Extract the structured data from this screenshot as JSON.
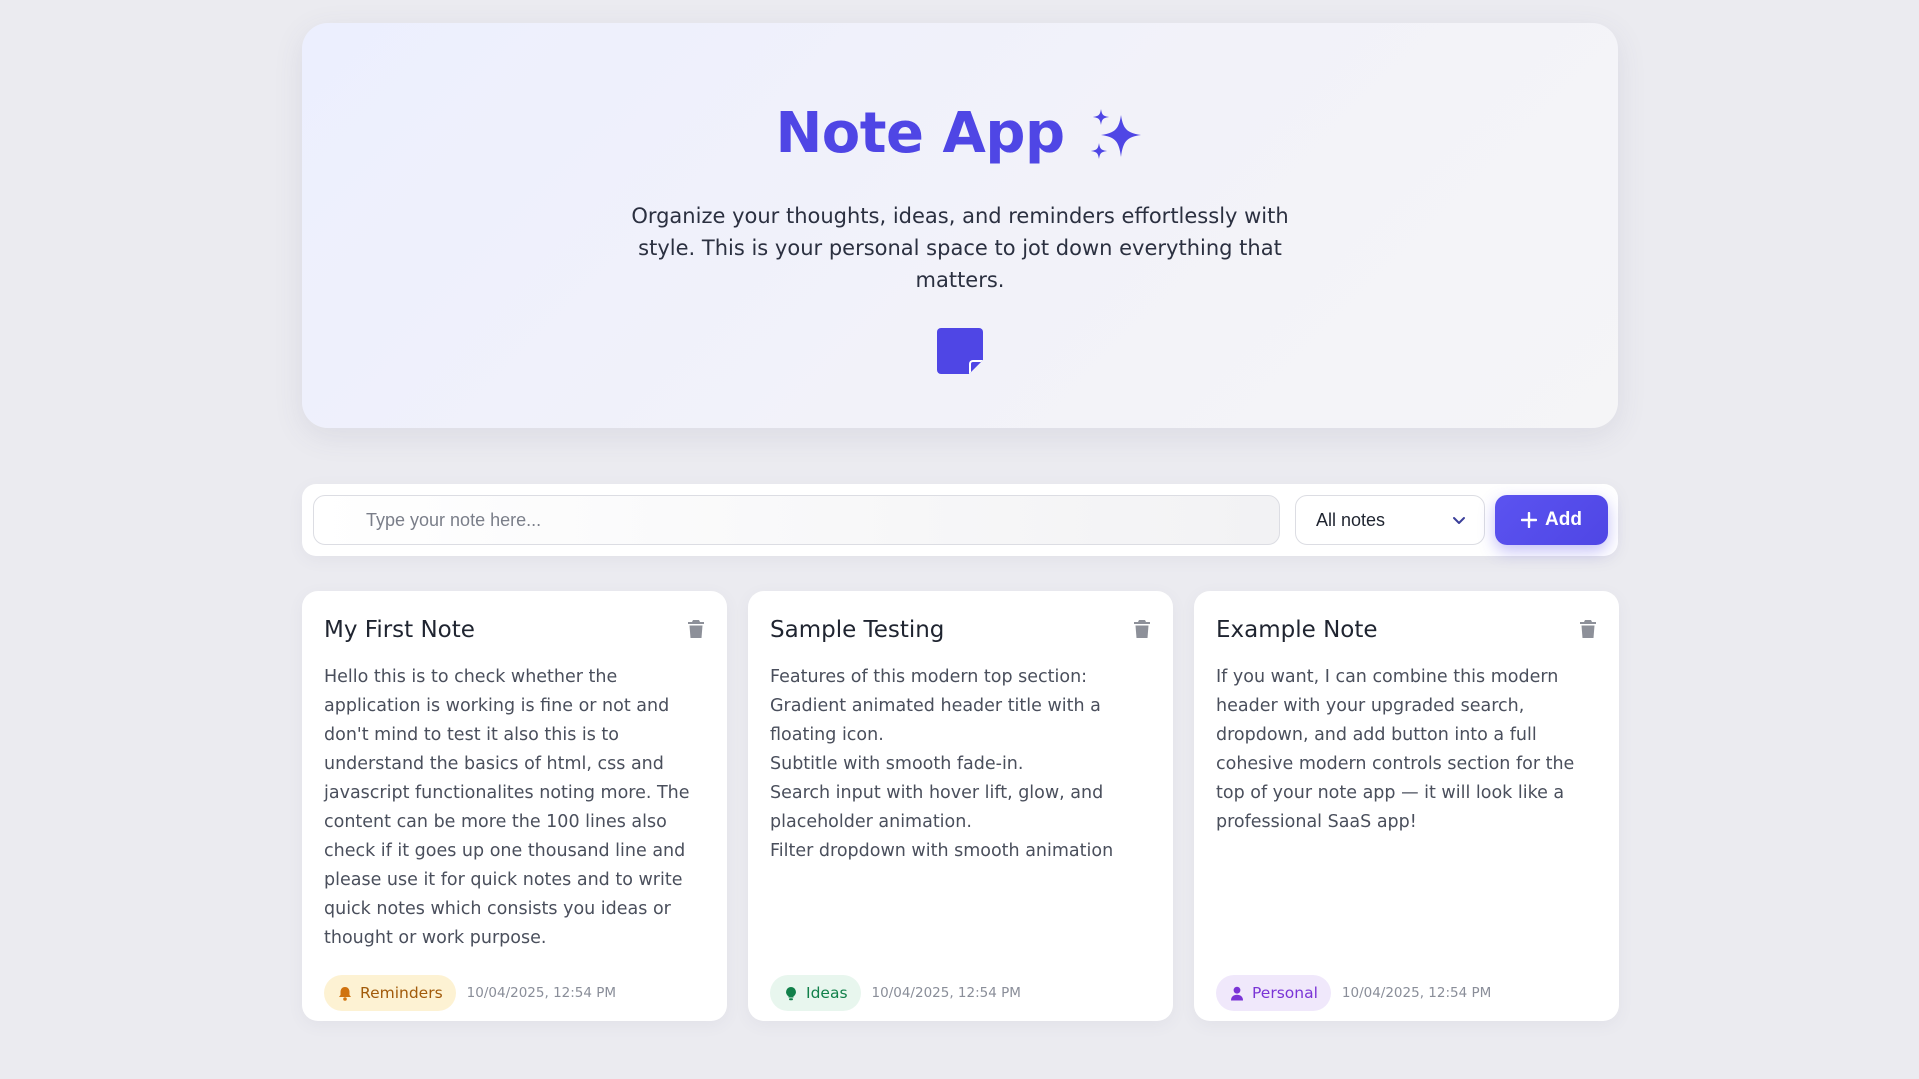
{
  "header": {
    "title": "Note App",
    "subtitle": "Organize your thoughts, ideas, and reminders effortlessly with style. This is your personal space to jot down everything that matters.",
    "title_icon": "sparkles-icon",
    "hero_icon": "sticky-note-icon"
  },
  "controls": {
    "search_placeholder": "Type your note here...",
    "filter_selected": "All notes",
    "add_label": "Add"
  },
  "notes": [
    {
      "title": "My First Note",
      "body": "Hello this is to check whether the application is working is fine or not and don't mind to test it also this is to understand the basics of html, css and javascript functionalites noting more. The content can be more the 100 lines also check if it goes up one thousand line and please use it for quick notes and to write quick notes which consists you ideas or thought or work purpose.",
      "category": "Reminders",
      "category_icon": "bell-icon",
      "timestamp": "10/04/2025, 12:54 PM"
    },
    {
      "title": "Sample Testing",
      "body": "Features of this modern top section:\nGradient animated header title with a floating icon.\nSubtitle with smooth fade-in.\nSearch input with hover lift, glow, and placeholder animation.\nFilter dropdown with smooth animation",
      "category": "Ideas",
      "category_icon": "lightbulb-icon",
      "timestamp": "10/04/2025, 12:54 PM"
    },
    {
      "title": "Example Note",
      "body": "If you want, I can combine this modern header with your upgraded search, dropdown, and add button into a full cohesive modern controls section for the top of your note app — it will look like a professional SaaS app!",
      "category": "Personal",
      "category_icon": "user-icon",
      "timestamp": "10/04/2025, 12:54 PM"
    }
  ],
  "colors": {
    "accent": "#4f46e5",
    "background": "#ebebf0",
    "reminders_bg": "#fdf2d3",
    "reminders_fg": "#a15a0a",
    "ideas_bg": "#e8f6ee",
    "ideas_fg": "#11804a",
    "personal_bg": "#f0e8fb",
    "personal_fg": "#7a34d6"
  }
}
